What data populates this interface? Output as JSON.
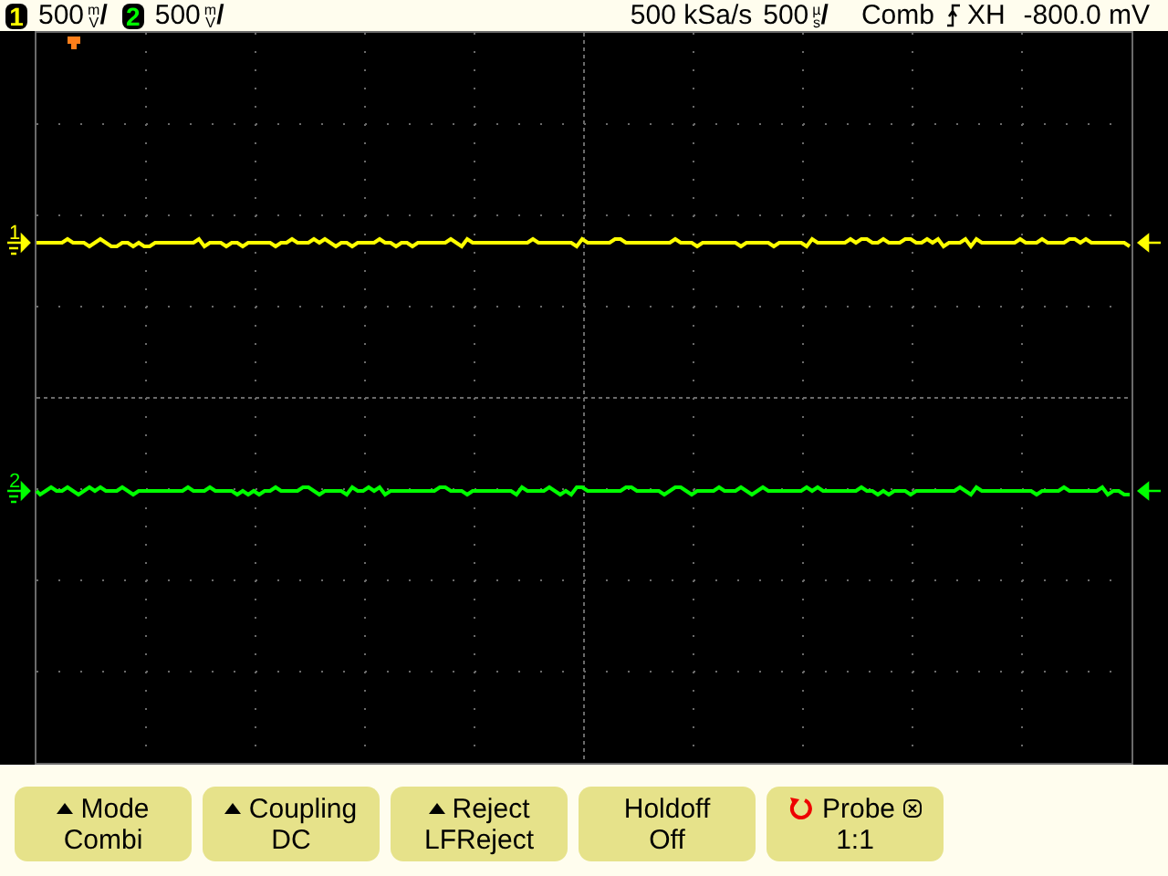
{
  "status_bar": {
    "channels": [
      {
        "number": "1",
        "scale": "500",
        "unit_top": "m",
        "unit_bottom": "V",
        "per_division": "/"
      },
      {
        "number": "2",
        "scale": "500",
        "unit_top": "m",
        "unit_bottom": "V",
        "per_division": "/"
      }
    ],
    "sample_rate": "500 kSa/s",
    "timebase": {
      "scale": "500",
      "unit_top": "µ",
      "unit_bottom": "s",
      "per_division": "/"
    },
    "trigger_mode": "Comb",
    "trigger_source": "XH",
    "trigger_level": "-800.0 mV"
  },
  "display": {
    "traces": [
      {
        "label": "1",
        "color": "#ffff00"
      },
      {
        "label": "2",
        "color": "#00ff00"
      }
    ]
  },
  "softkeys": [
    {
      "kind": "menu",
      "label": "Mode",
      "value": "Combi"
    },
    {
      "kind": "menu",
      "label": "Coupling",
      "value": "DC"
    },
    {
      "kind": "menu",
      "label": "Reject",
      "value": "LFReject"
    },
    {
      "kind": "plain",
      "label": "Holdoff",
      "value": "Off"
    },
    {
      "kind": "knob",
      "label": "Probe",
      "value": "1:1"
    }
  ]
}
